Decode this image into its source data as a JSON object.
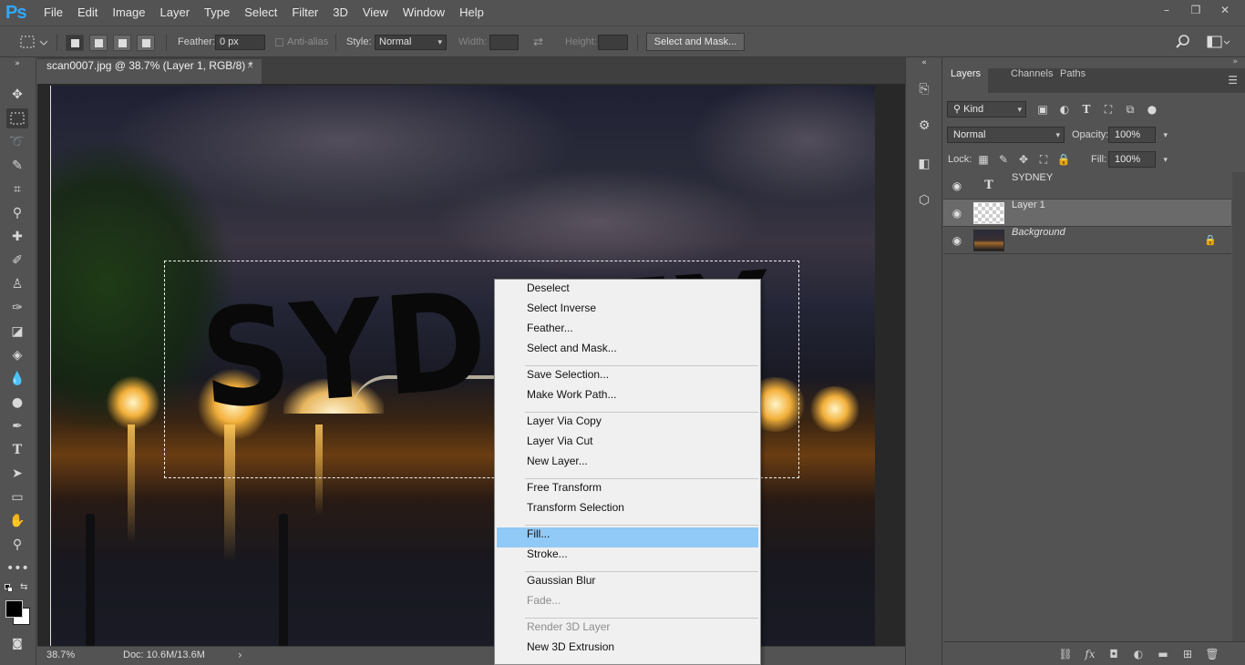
{
  "app": {
    "logo": "Ps",
    "menu": [
      "File",
      "Edit",
      "Image",
      "Layer",
      "Type",
      "Select",
      "Filter",
      "3D",
      "View",
      "Window",
      "Help"
    ],
    "window_controls": {
      "minimize": "–",
      "restore": "❐",
      "close": "✕"
    }
  },
  "options_bar": {
    "feather_label": "Feather:",
    "feather_value": "0 px",
    "anti_alias_label": "Anti-alias",
    "style_label": "Style:",
    "style_value": "Normal",
    "width_label": "Width:",
    "height_label": "Height:",
    "select_and_mask_button": "Select and Mask..."
  },
  "document": {
    "tab_title": "scan0007.jpg @ 38.7% (Layer 1, RGB/8) *",
    "tab_close": "×",
    "canvas_text": "SYDNEY",
    "zoom": "38.7%",
    "doc_size": "Doc: 10.6M/13.6M"
  },
  "context_menu": {
    "items": [
      {
        "label": "Deselect",
        "enabled": true,
        "highlighted": false
      },
      {
        "label": "Select Inverse",
        "enabled": true,
        "highlighted": false
      },
      {
        "label": "Feather...",
        "enabled": true,
        "highlighted": false
      },
      {
        "label": "Select and Mask...",
        "enabled": true,
        "highlighted": false
      },
      {
        "label": "Save Selection...",
        "enabled": true,
        "highlighted": false
      },
      {
        "label": "Make Work Path...",
        "enabled": true,
        "highlighted": false
      },
      {
        "label": "Layer Via Copy",
        "enabled": true,
        "highlighted": false
      },
      {
        "label": "Layer Via Cut",
        "enabled": true,
        "highlighted": false
      },
      {
        "label": "New Layer...",
        "enabled": true,
        "highlighted": false
      },
      {
        "label": "Free Transform",
        "enabled": true,
        "highlighted": false
      },
      {
        "label": "Transform Selection",
        "enabled": true,
        "highlighted": false
      },
      {
        "label": "Fill...",
        "enabled": true,
        "highlighted": true
      },
      {
        "label": "Stroke...",
        "enabled": true,
        "highlighted": false
      },
      {
        "label": "Gaussian Blur",
        "enabled": true,
        "highlighted": false
      },
      {
        "label": "Fade...",
        "enabled": false,
        "highlighted": false
      },
      {
        "label": "Render 3D Layer",
        "enabled": false,
        "highlighted": false
      },
      {
        "label": "New 3D Extrusion",
        "enabled": true,
        "highlighted": false
      }
    ]
  },
  "layers_panel": {
    "tabs": [
      "Layers",
      "Channels",
      "Paths"
    ],
    "active_tab": "Layers",
    "filter_kind": "Kind",
    "blend_mode": "Normal",
    "opacity_label": "Opacity:",
    "opacity_value": "100%",
    "lock_label": "Lock:",
    "fill_label": "Fill:",
    "fill_value": "100%",
    "layers": [
      {
        "name": "SYDNEY",
        "type": "text",
        "visible": true,
        "selected": false,
        "locked": false
      },
      {
        "name": "Layer 1",
        "type": "pixel",
        "visible": true,
        "selected": true,
        "locked": false
      },
      {
        "name": "Background",
        "type": "background",
        "visible": true,
        "selected": false,
        "locked": true
      }
    ]
  },
  "colors": {
    "ui_bg": "#535353",
    "menu_highlight": "#91c9f7",
    "ps_blue": "#31a8ff"
  }
}
